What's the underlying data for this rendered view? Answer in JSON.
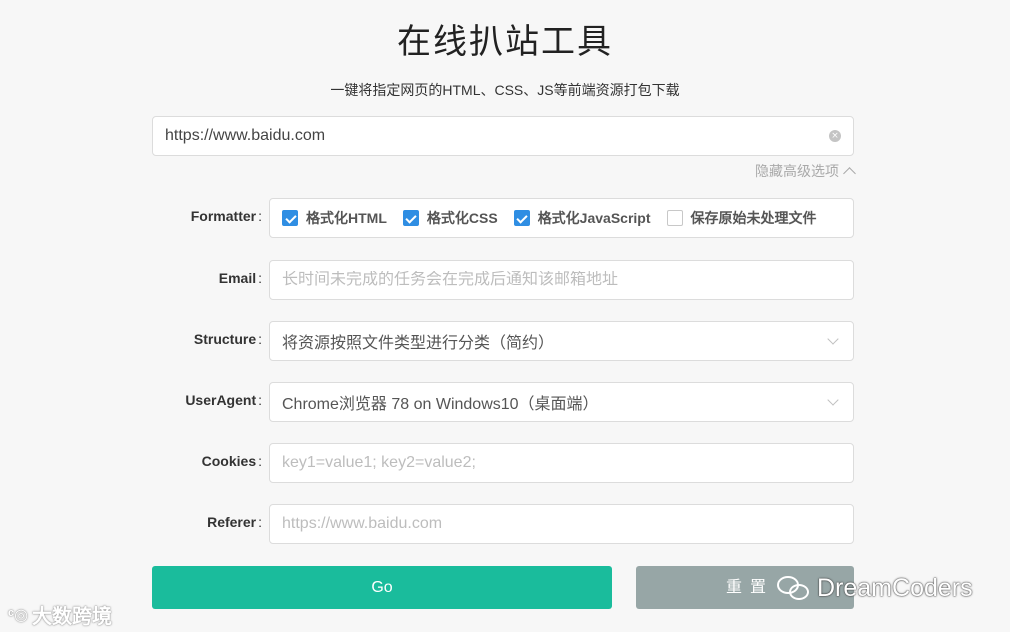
{
  "header": {
    "title": "在线扒站工具",
    "subtitle": "一键将指定网页的HTML、CSS、JS等前端资源打包下载"
  },
  "url": {
    "value": "https://www.baidu.com"
  },
  "advanced": {
    "label": "隐藏高级选项"
  },
  "form": {
    "formatter": {
      "label": "Formatter",
      "options": [
        {
          "label": "格式化HTML",
          "checked": true
        },
        {
          "label": "格式化CSS",
          "checked": true
        },
        {
          "label": "格式化JavaScript",
          "checked": true
        },
        {
          "label": "保存原始未处理文件",
          "checked": false
        }
      ]
    },
    "email": {
      "label": "Email",
      "placeholder": "长时间未完成的任务会在完成后通知该邮箱地址"
    },
    "structure": {
      "label": "Structure",
      "value": "将资源按照文件类型进行分类（简约）"
    },
    "useragent": {
      "label": "UserAgent",
      "value": "Chrome浏览器 78 on Windows10（桌面端）"
    },
    "cookies": {
      "label": "Cookies",
      "placeholder": "key1=value1; key2=value2;"
    },
    "referer": {
      "label": "Referer",
      "placeholder": "https://www.baidu.com"
    }
  },
  "buttons": {
    "go": "Go",
    "reset": "重置"
  },
  "watermarks": {
    "left": "大数跨境",
    "right": "DreamCoders"
  },
  "colors": {
    "primary": "#1abc9c",
    "secondary": "#97a6a6",
    "checkbox": "#2f8ee3"
  }
}
